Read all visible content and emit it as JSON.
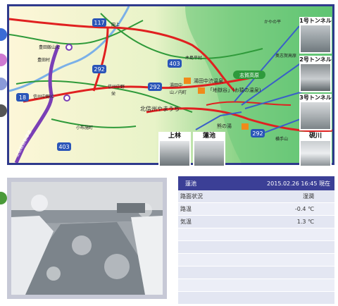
{
  "map": {
    "route_badges": [
      "117",
      "292",
      "403",
      "18",
      "292",
      "292",
      "403"
    ],
    "place_labels": [
      "豊田飯山IC",
      "豊田村",
      "田上",
      "栄",
      "木島平村",
      "かやの平",
      "信州中野IC",
      "信州中野",
      "湯田中",
      "山ノ内町",
      "北信州やまうち",
      "小布施町",
      "志賀高原",
      "湯田中渋温泉",
      "「地獄谷」(お猿の温泉)",
      "熊の湯",
      "横手山",
      "渋峠",
      "奥志賀高原",
      "上信越自動車道"
    ],
    "camera_labels": [
      "1号トンネル",
      "2号トンネル",
      "3号トンネル",
      "上林",
      "蓮池",
      "硯川"
    ]
  },
  "info": {
    "location": "蓮池",
    "datetime": "2015.02.26  16:45 現在",
    "rows": [
      {
        "label": "路面状況",
        "value": "湿潤"
      },
      {
        "label": "路温",
        "value": "-0.4 ℃"
      },
      {
        "label": "気温",
        "value": "1.3 ℃"
      },
      {
        "label": "",
        "value": ""
      },
      {
        "label": "",
        "value": ""
      },
      {
        "label": "",
        "value": ""
      },
      {
        "label": "",
        "value": ""
      },
      {
        "label": "",
        "value": ""
      },
      {
        "label": "",
        "value": ""
      }
    ]
  },
  "colors": {
    "frame": "#2f3a8c",
    "header": "#3b3f96",
    "route_badge": "#2a55b8",
    "highway": "#7a3fb6",
    "road_red": "#e02020"
  }
}
